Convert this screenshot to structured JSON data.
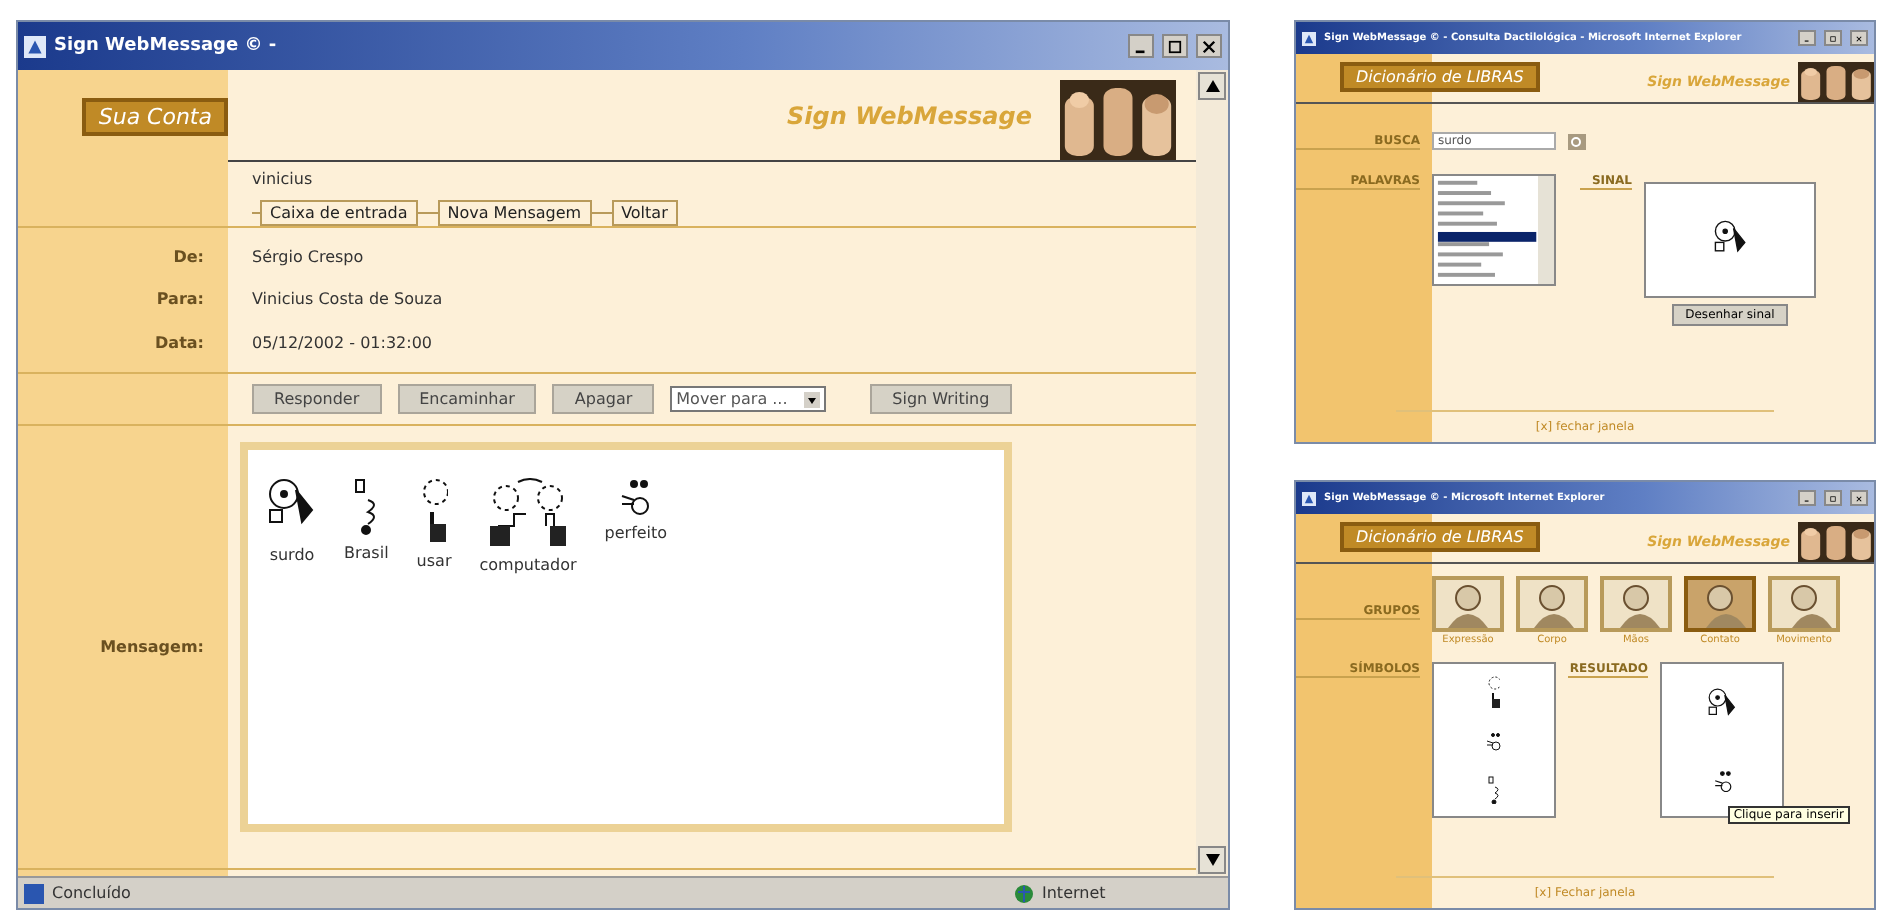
{
  "main_window": {
    "title": "Sign WebMessage © -",
    "account_tab": "Sua Conta",
    "brand": "Sign WebMessage",
    "username": "vinicius",
    "nav_buttons": [
      "Caixa de entrada",
      "Nova Mensagem",
      "Voltar"
    ],
    "fields": [
      {
        "label": "De:",
        "value": "Sérgio Crespo"
      },
      {
        "label": "Para:",
        "value": "Vinicius Costa de Souza"
      },
      {
        "label": "Data:",
        "value": "05/12/2002 - 01:32:00"
      }
    ],
    "actions": [
      {
        "kind": "button",
        "label": "Responder"
      },
      {
        "kind": "button",
        "label": "Encaminhar"
      },
      {
        "kind": "button",
        "label": "Apagar"
      },
      {
        "kind": "select",
        "value": "Mover para ..."
      },
      {
        "kind": "button",
        "label": "Sign Writing"
      }
    ],
    "message_label": "Mensagem:",
    "signs": [
      {
        "word": "surdo"
      },
      {
        "word": "Brasil"
      },
      {
        "word": "usar"
      },
      {
        "word": "computador"
      },
      {
        "word": "perfeito"
      }
    ],
    "status_bar": {
      "text": "Concluído",
      "zone": "Internet"
    }
  },
  "search_window": {
    "title": "Sign WebMessage © - Consulta Dactilológica - Microsoft Internet Explorer",
    "header": "Dicionário de LIBRAS",
    "brand": "Sign WebMessage",
    "search_label": "BUSCA",
    "search_value": "surdo",
    "words_label": "PALAVRAS",
    "sign_label": "SINAL",
    "draw_button": "Desenhar sinal",
    "close_link": "[x] fechar janela"
  },
  "groups_window": {
    "title": "Sign WebMessage © - Microsoft Internet Explorer",
    "header": "Dicionário de LIBRAS",
    "brand": "Sign WebMessage",
    "groups_label": "GRUPOS",
    "groups": [
      {
        "label": "Expressão",
        "selected": false
      },
      {
        "label": "Corpo",
        "selected": false
      },
      {
        "label": "Mãos",
        "selected": false
      },
      {
        "label": "Contato",
        "selected": true
      },
      {
        "label": "Movimento",
        "selected": false
      }
    ],
    "symbols_label": "SÍMBOLOS",
    "result_label": "RESULTADO",
    "tooltip": "Clique para inserir",
    "close_link": "[x] Fechar janela"
  }
}
